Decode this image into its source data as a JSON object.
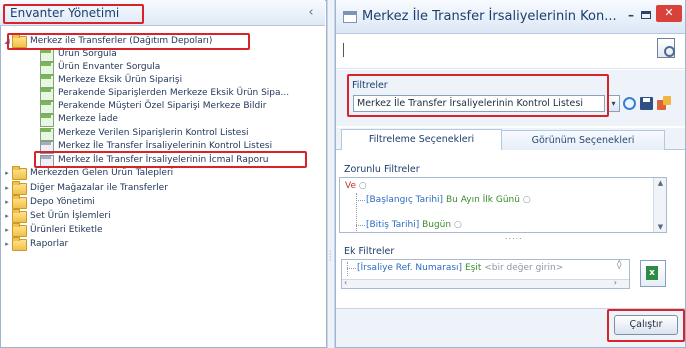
{
  "left_panel": {
    "title": "Envanter Yönetimi",
    "collapse_glyph": "‹",
    "tree": [
      {
        "label": "Merkez ile Transferler (Dağıtım Depoları)",
        "type": "folder",
        "expanded": true,
        "level": 0
      },
      {
        "label": "Ürün Sorgula",
        "type": "doc",
        "level": 1
      },
      {
        "label": "Ürün Envanter Sorgula",
        "type": "doc",
        "level": 1
      },
      {
        "label": "Merkeze Eksik Ürün Siparişi",
        "type": "doc",
        "level": 1
      },
      {
        "label": "Perakende Siparişlerden Merkeze Eksik Ürün Sipa...",
        "type": "doc",
        "level": 1
      },
      {
        "label": "Perakende Müşteri Özel Siparişi Merkeze Bildir",
        "type": "doc",
        "level": 1
      },
      {
        "label": "Merkeze İade",
        "type": "doc",
        "level": 1
      },
      {
        "label": "Merkeze Verilen Siparişlerin Kontrol Listesi",
        "type": "doc",
        "level": 1
      },
      {
        "label": "Merkez İle Transfer İrsaliyelerinin Kontrol Listesi",
        "type": "doc-gray",
        "level": 1,
        "selected": true
      },
      {
        "label": "Merkez İle Transfer İrsaliyelerinin İcmal Raporu",
        "type": "doc-gray",
        "level": 1
      },
      {
        "label": "Merkezden Gelen Ürün Talepleri",
        "type": "folder",
        "level": 0
      },
      {
        "label": "Diğer Mağazalar ile Transferler",
        "type": "folder",
        "level": 0
      },
      {
        "label": "Depo Yönetimi",
        "type": "folder",
        "level": 0
      },
      {
        "label": "Set Ürün İşlemleri",
        "type": "folder",
        "level": 0
      },
      {
        "label": "Ürünleri Etiketle",
        "type": "folder",
        "level": 0
      },
      {
        "label": "Raporlar",
        "type": "folder",
        "level": 0
      }
    ]
  },
  "window": {
    "title": "Merkez İle Transfer İrsaliyelerinin Kon...",
    "min_glyph": "–",
    "close_glyph": "✕"
  },
  "filters": {
    "label": "Filtreler",
    "selected": "Merkez İle Transfer İrsaliyelerinin Kontrol Listesi",
    "dropdown_glyph": "▾"
  },
  "tabs": [
    {
      "label": "Filtreleme Seçenekleri",
      "active": true
    },
    {
      "label": "Görünüm Seçenekleri",
      "active": false
    }
  ],
  "mandatory_filters": {
    "label": "Zorunlu Filtreler",
    "operator": "Ve",
    "conditions": [
      {
        "field": "[Başlangıç Tarihi]",
        "op": "Bu Ayın İlk Günü"
      },
      {
        "field": "[Bitiş Tarihi]",
        "op": "Bugün"
      }
    ],
    "more": "....."
  },
  "extra_filters": {
    "label": "Ek Filtreler",
    "field": "[İrsaliye Ref. Numarası]",
    "op": "Eşit",
    "value_placeholder": "<bir değer girin>"
  },
  "run_button": "Çalıştır",
  "colors": {
    "highlight_red": "#d8232a",
    "header_blue": "#1d3f6e",
    "close_red": "#d9423a"
  }
}
